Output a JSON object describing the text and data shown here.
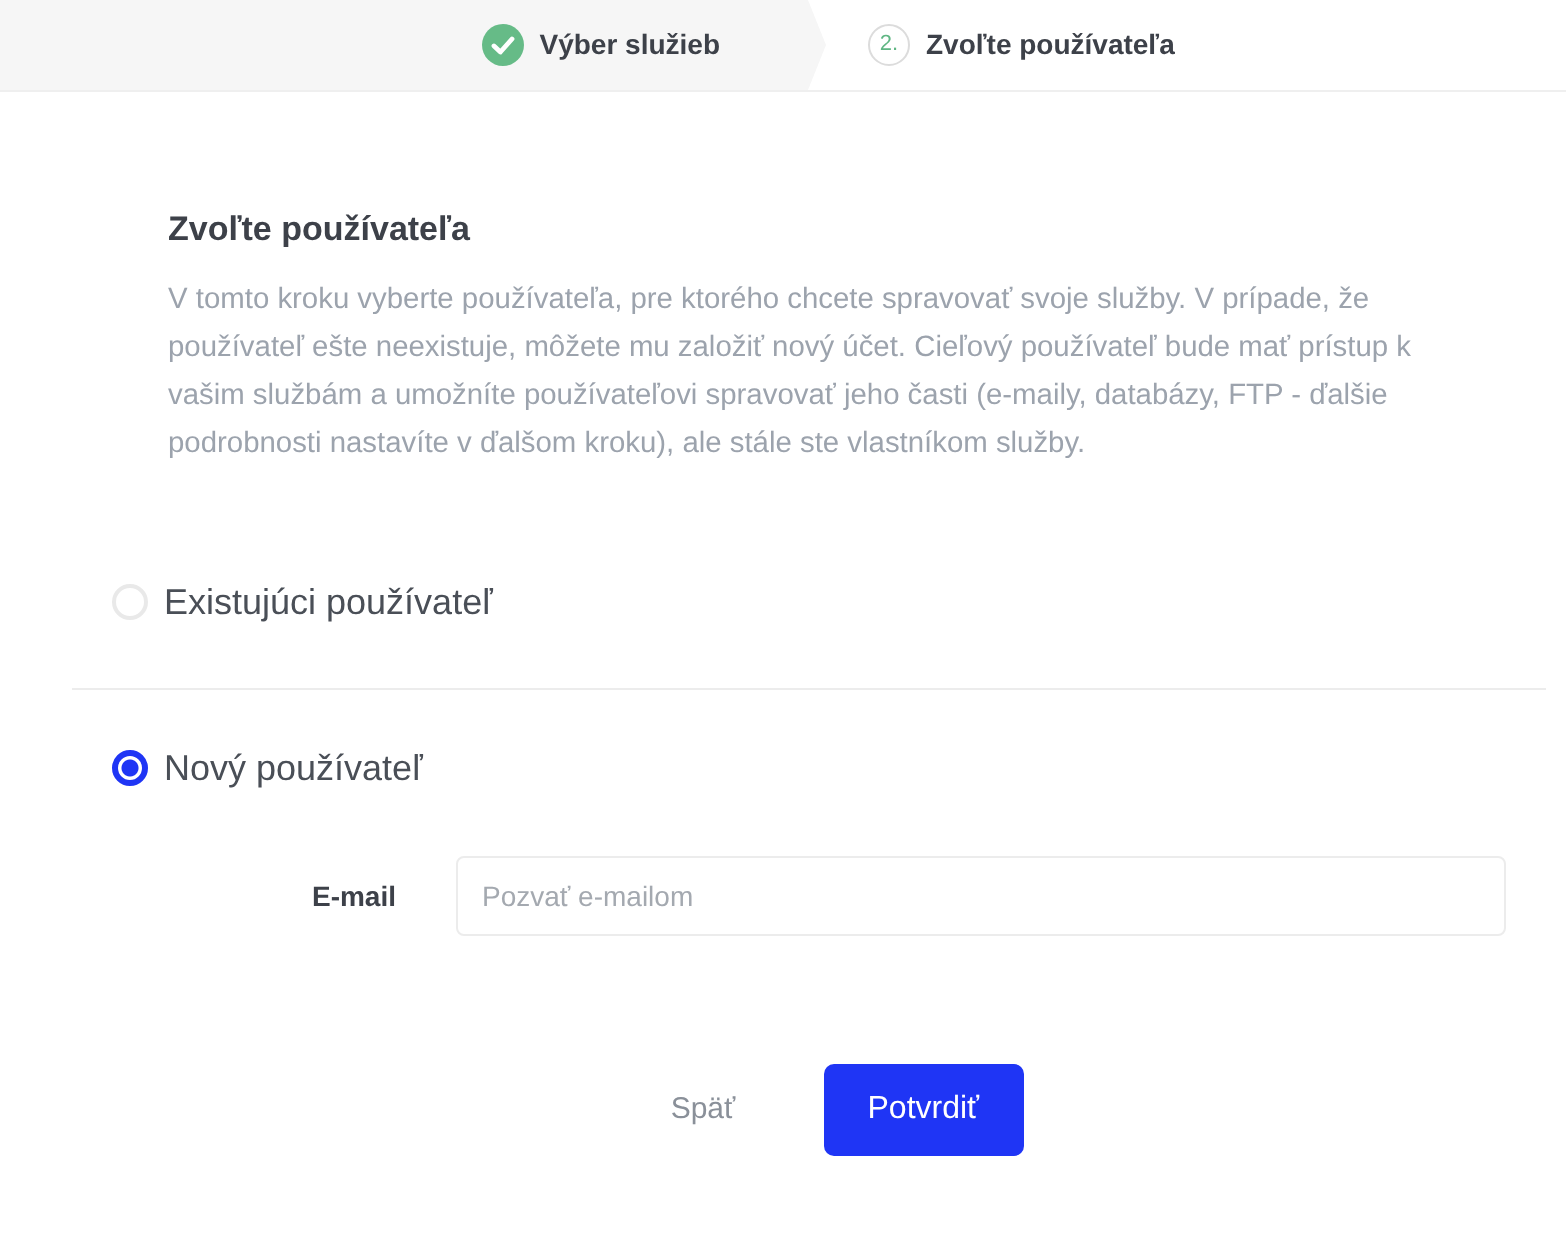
{
  "steps": [
    {
      "label": "Výber služieb",
      "completed": true
    },
    {
      "number": "2.",
      "label": "Zvoľte používateľa",
      "completed": false
    }
  ],
  "heading": "Zvoľte používateľa",
  "description": "V tomto kroku vyberte používateľa, pre ktorého chcete spravovať svoje služby. V prípade, že používateľ ešte neexistuje, môžete mu založiť nový účet. Cieľový používateľ bude mať prístup k vašim službám a umožníte používateľovi spravovať jeho časti (e-maily, databázy, FTP - ďalšie podrobnosti nastavíte v ďalšom kroku), ale stále ste vlastníkom služby.",
  "options": [
    {
      "label": "Existujúci používateľ",
      "selected": false
    },
    {
      "label": "Nový používateľ",
      "selected": true,
      "field": {
        "label": "E-mail",
        "placeholder": "Pozvať e-mailom"
      }
    }
  ],
  "actions": [
    {
      "kind": "link",
      "label": "Späť"
    },
    {
      "kind": "primary",
      "label": "Potvrdiť"
    }
  ]
}
